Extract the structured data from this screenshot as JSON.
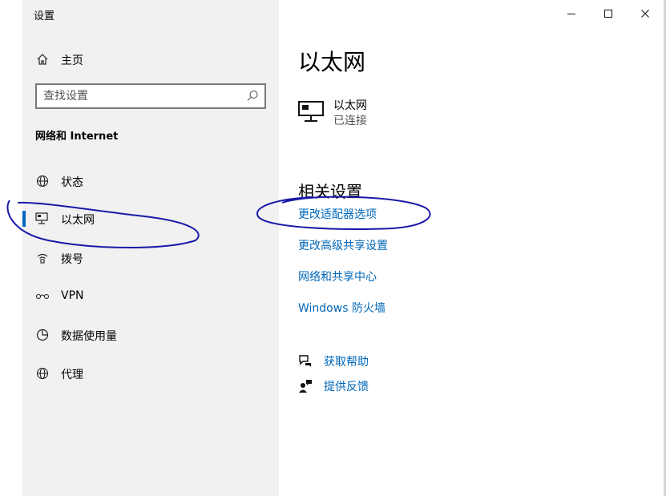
{
  "window": {
    "title": "设置",
    "controls": {
      "minimize": "minimize-icon",
      "maximize": "maximize-icon",
      "close": "close-icon"
    }
  },
  "sidebar": {
    "home_label": "主页",
    "search_placeholder": "查找设置",
    "section_title": "网络和 Internet",
    "items": [
      {
        "label": "状态",
        "icon": "globe-status-icon"
      },
      {
        "label": "以太网",
        "icon": "ethernet-icon",
        "selected": true
      },
      {
        "label": "拨号",
        "icon": "dialup-icon"
      },
      {
        "label": "VPN",
        "icon": "vpn-icon"
      },
      {
        "label": "数据使用量",
        "icon": "data-usage-icon"
      },
      {
        "label": "代理",
        "icon": "globe-proxy-icon"
      }
    ]
  },
  "main": {
    "page_title": "以太网",
    "adapter": {
      "name": "以太网",
      "status": "已连接",
      "icon": "ethernet-adapter-icon"
    },
    "related_title": "相关设置",
    "related_links": [
      "更改适配器选项",
      "更改高级共享设置",
      "网络和共享中心",
      "Windows 防火墙"
    ],
    "help": {
      "get_help": "获取帮助",
      "feedback": "提供反馈"
    }
  },
  "colors": {
    "accent": "#0067c0",
    "link": "#0067b8",
    "sidebar_bg": "#f1f1f1",
    "annotation_ink": "#1a1aa8"
  }
}
